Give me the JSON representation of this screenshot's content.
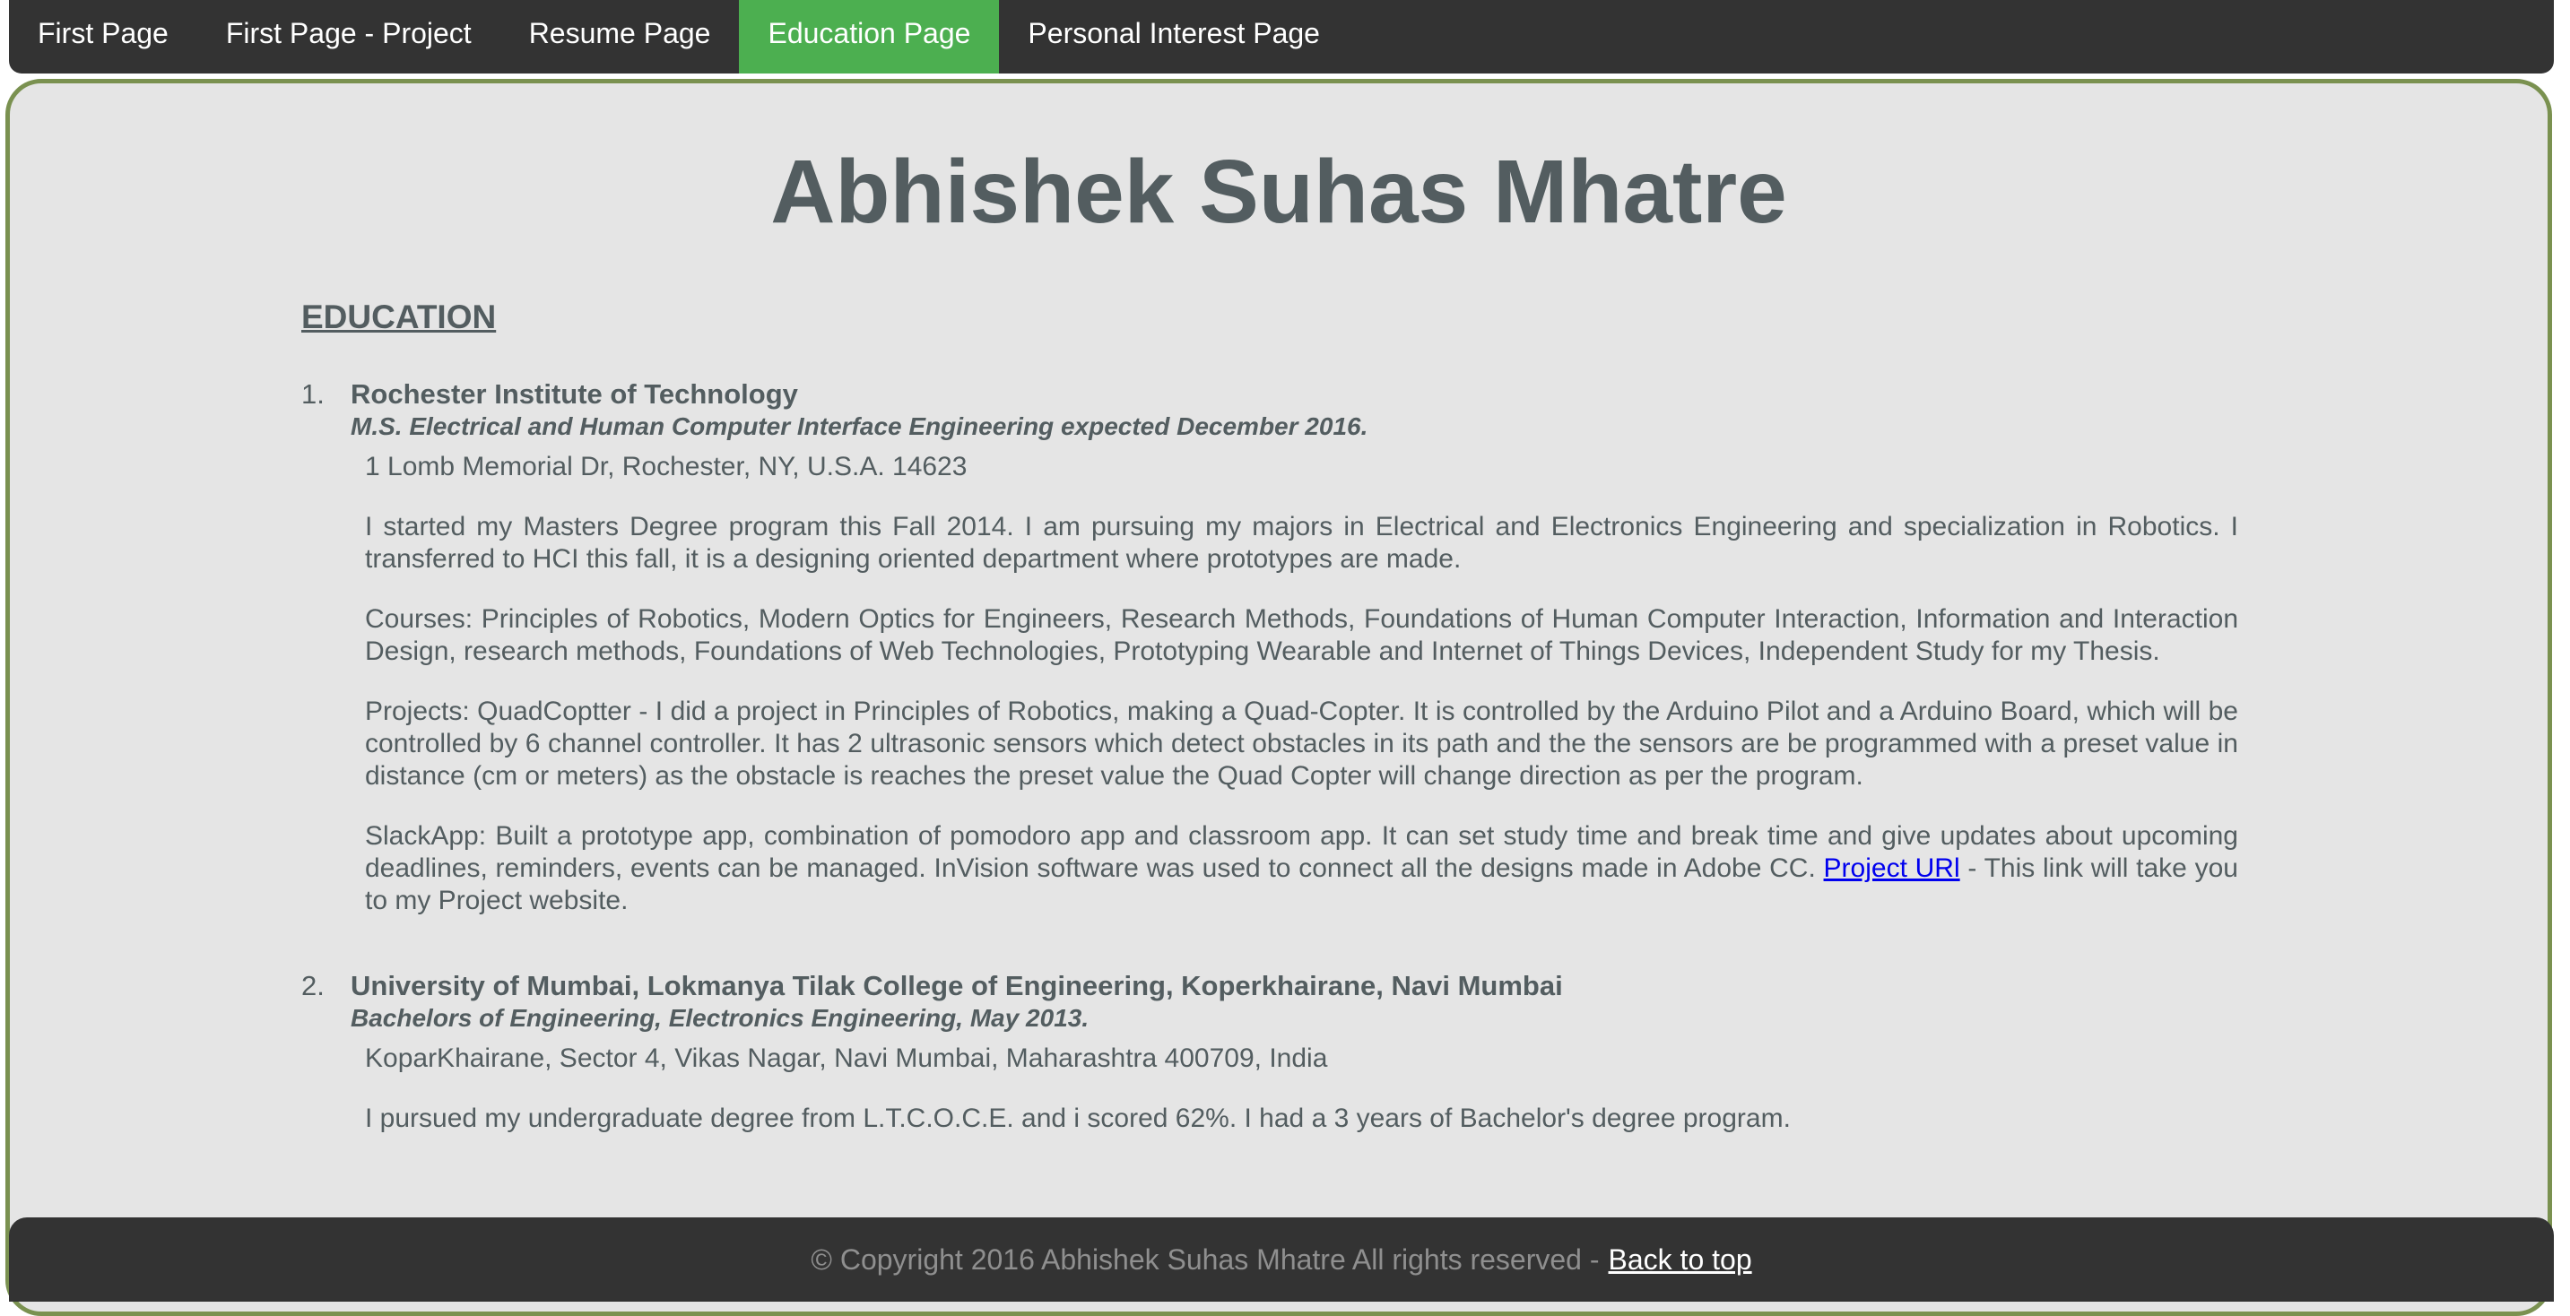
{
  "nav": {
    "items": [
      {
        "label": "First Page"
      },
      {
        "label": "First Page - Project"
      },
      {
        "label": "Resume Page"
      },
      {
        "label": "Education Page"
      },
      {
        "label": "Personal Interest Page"
      }
    ],
    "active_index": 3,
    "active_color": "#4caf50"
  },
  "page": {
    "title": "Abhishek Suhas Mhatre",
    "section_heading": "EDUCATION"
  },
  "education": [
    {
      "number": "1.",
      "institution": "Rochester Institute of Technology",
      "degree": "M.S. Electrical and Human Computer Interface Engineering expected December 2016.",
      "address": "1 Lomb Memorial Dr, Rochester, NY, U.S.A. 14623",
      "summary": "I started my Masters Degree program this Fall 2014. I am pursuing my majors in Electrical and Electronics Engineering and specialization in Robotics. I transferred to HCI this fall, it is a designing oriented department where prototypes are made.",
      "courses": "Courses: Principles of Robotics, Modern Optics for Engineers, Research Methods, Foundations of Human Computer Interaction, Information and Interaction Design, research methods, Foundations of Web Technologies, Prototyping Wearable and Internet of Things Devices, Independent Study for my Thesis.",
      "projects": "Projects: QuadCoptter - I did a project in Principles of Robotics, making a Quad-Copter. It is controlled by the Arduino Pilot and a Arduino Board, which will be controlled by 6 channel controller. It has 2 ultrasonic sensors which detect obstacles in its path and the the sensors are be programmed with a preset value in distance (cm or meters) as the obstacle is reaches the preset value the Quad Copter will change direction as per the program.",
      "slackapp_text": "SlackApp: Built a prototype app, combination of pomodoro app and classroom app. It can set study time and break time and give updates about upcoming deadlines, reminders, events can be managed. InVision software was used to connect all the designs made in Adobe CC. ",
      "slackapp_link": "Project URl",
      "slackapp_after": " - This link will take you to my Project website."
    },
    {
      "number": "2.",
      "institution": "University of Mumbai, Lokmanya Tilak College of Engineering, Koperkhairane, Navi Mumbai",
      "degree": "Bachelors of Engineering, Electronics Engineering, May 2013.",
      "address": "KoparKhairane, Sector 4, Vikas Nagar, Navi Mumbai, Maharashtra 400709, India",
      "summary": "I pursued my undergraduate degree from L.T.C.O.C.E. and i scored 62%. I had a 3 years of Bachelor's degree program."
    }
  ],
  "footer": {
    "copyright": "© Copyright 2016 Abhishek Suhas Mhatre All rights reserved -",
    "back_to_top": "Back to top"
  },
  "colors": {
    "nav_bg": "#333333",
    "content_bg": "#e5e5e5",
    "frame_border": "#7a9150",
    "text": "#535d60",
    "link": "#0000ee"
  }
}
